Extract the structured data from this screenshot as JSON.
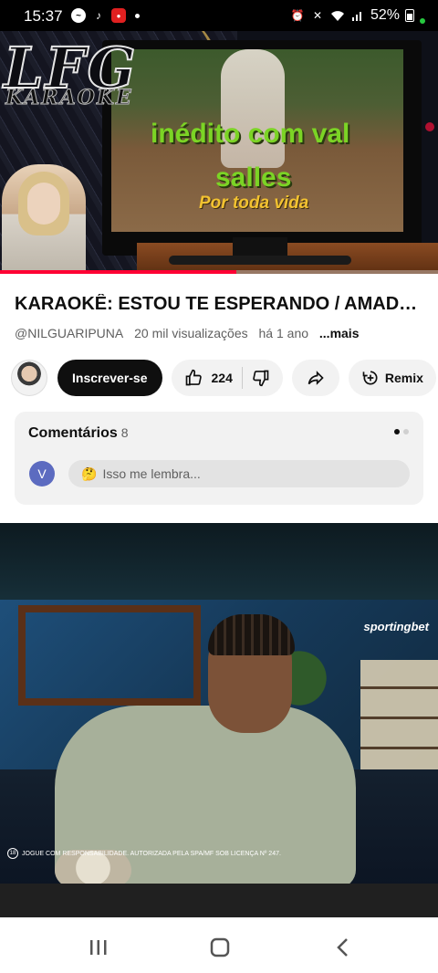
{
  "status_bar": {
    "time": "15:37",
    "battery": "52%",
    "icons": [
      "messenger-icon",
      "tiktok-icon",
      "cnn-icon",
      "dot-icon",
      "alarm-icon",
      "mute-icon",
      "wifi-icon",
      "signal-icon",
      "battery-icon"
    ]
  },
  "player": {
    "logo": "LFG",
    "logo_sub": "KARAOKE",
    "lyric_line1": "inédito com  val",
    "lyric_line2": "salles",
    "lyric_line3": "Por toda vida",
    "progress": 0.54
  },
  "video": {
    "title": "KARAOKÊ: ESTOU TE ESPERANDO / AMADO ...",
    "channel": "@NILGUARIPUNA",
    "views": "20 mil visualizações",
    "age": "há 1 ano",
    "more": "...mais"
  },
  "actions": {
    "subscribe_label": "Inscrever-se",
    "like_count": "224",
    "remix_label": "Remix"
  },
  "comments": {
    "title": "Comentários",
    "count": "8",
    "user_initial": "V",
    "placeholder": "Isso me lembra..."
  },
  "ad": {
    "brand": "sportingbet",
    "age_badge": "18",
    "disclaimer": "JOGUE COM RESPONSABILIDADE. AUTORIZADA PELA SPA/MF SOB LICENÇA Nº 247."
  },
  "colors": {
    "accent": "#ff0033",
    "lyric_green": "#7bd425",
    "lyric_yellow": "#f2c230",
    "subscribe_bg": "#0f0f0f"
  }
}
